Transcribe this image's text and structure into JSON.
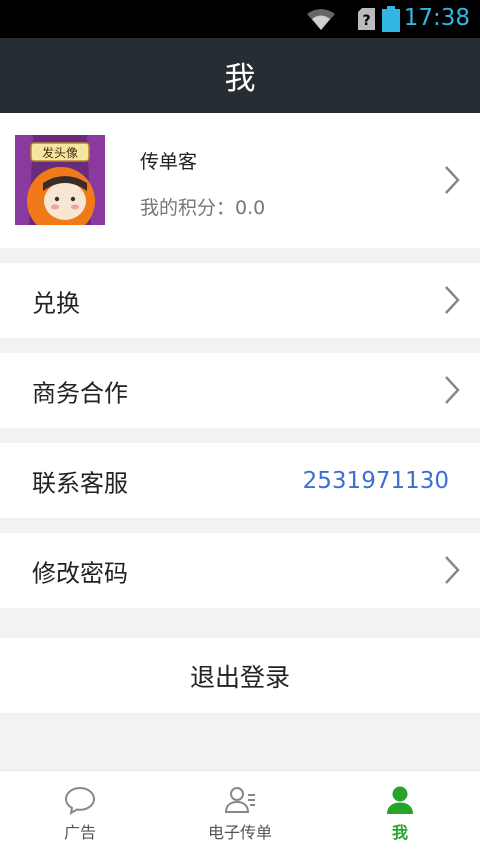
{
  "status_bar": {
    "time": "17:38"
  },
  "header": {
    "title": "我"
  },
  "profile": {
    "name": "传单客",
    "points_label": "我的积分：0.0",
    "avatar_badge_text": "发头像"
  },
  "menu": {
    "exchange_label": "兑换",
    "business_label": "商务合作",
    "service_label": "联系客服",
    "service_value": "2531971130",
    "password_label": "修改密码"
  },
  "logout": {
    "label": "退出登录"
  },
  "tabs": [
    {
      "label": "广告",
      "icon": "chat-bubble-icon",
      "active": false
    },
    {
      "label": "电子传单",
      "icon": "contacts-icon",
      "active": false
    },
    {
      "label": "我",
      "icon": "person-icon",
      "active": true
    }
  ],
  "colors": {
    "accent_green": "#28a32c",
    "header_bg": "#262d33",
    "link_blue": "#3c6fd3",
    "status_time": "#33b5e5"
  }
}
